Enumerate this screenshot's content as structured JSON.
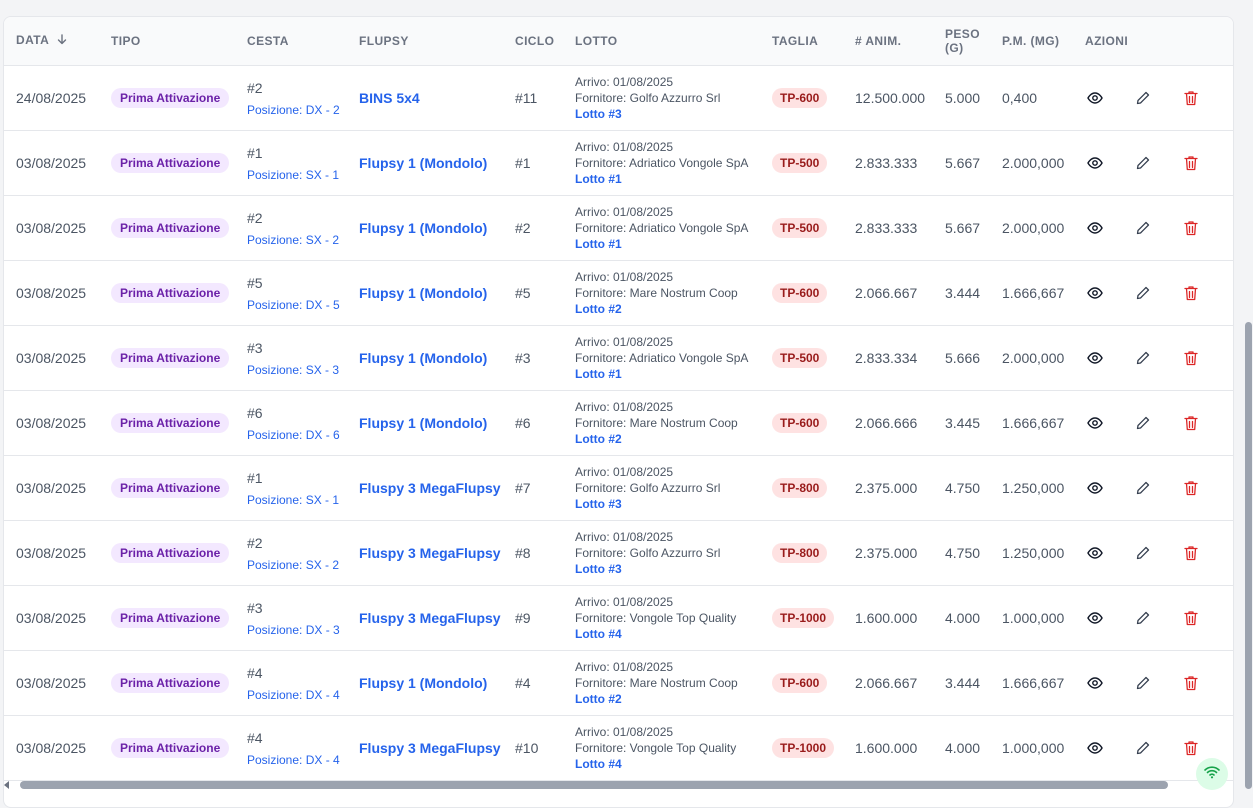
{
  "headers": {
    "data": "DATA",
    "tipo": "TIPO",
    "cesta": "CESTA",
    "flupsy": "FLUPSY",
    "ciclo": "CICLO",
    "lotto": "LOTTO",
    "taglia": "TAGLIA",
    "animali": "# ANIM.",
    "peso": "PESO (G)",
    "pm": "P.M. (MG)",
    "azioni": "AZIONI"
  },
  "rows": [
    {
      "data": "24/08/2025",
      "tipo": "Prima Attivazione",
      "cesta": "#2",
      "posizione": "Posizione: DX - 2",
      "flupsy": "BINS 5x4",
      "ciclo": "#11",
      "arrivo": "Arrivo: 01/08/2025",
      "fornitore": "Fornitore: Golfo Azzurro Srl",
      "lotto": "Lotto #3",
      "taglia": "TP-600",
      "animali": "12.500.000",
      "peso": "5.000",
      "pm": "0,400"
    },
    {
      "data": "03/08/2025",
      "tipo": "Prima Attivazione",
      "cesta": "#1",
      "posizione": "Posizione: SX - 1",
      "flupsy": "Flupsy 1 (Mondolo)",
      "ciclo": "#1",
      "arrivo": "Arrivo: 01/08/2025",
      "fornitore": "Fornitore: Adriatico Vongole SpA",
      "lotto": "Lotto #1",
      "taglia": "TP-500",
      "animali": "2.833.333",
      "peso": "5.667",
      "pm": "2.000,000"
    },
    {
      "data": "03/08/2025",
      "tipo": "Prima Attivazione",
      "cesta": "#2",
      "posizione": "Posizione: SX - 2",
      "flupsy": "Flupsy 1 (Mondolo)",
      "ciclo": "#2",
      "arrivo": "Arrivo: 01/08/2025",
      "fornitore": "Fornitore: Adriatico Vongole SpA",
      "lotto": "Lotto #1",
      "taglia": "TP-500",
      "animali": "2.833.333",
      "peso": "5.667",
      "pm": "2.000,000"
    },
    {
      "data": "03/08/2025",
      "tipo": "Prima Attivazione",
      "cesta": "#5",
      "posizione": "Posizione: DX - 5",
      "flupsy": "Flupsy 1 (Mondolo)",
      "ciclo": "#5",
      "arrivo": "Arrivo: 01/08/2025",
      "fornitore": "Fornitore: Mare Nostrum Coop",
      "lotto": "Lotto #2",
      "taglia": "TP-600",
      "animali": "2.066.667",
      "peso": "3.444",
      "pm": "1.666,667"
    },
    {
      "data": "03/08/2025",
      "tipo": "Prima Attivazione",
      "cesta": "#3",
      "posizione": "Posizione: SX - 3",
      "flupsy": "Flupsy 1 (Mondolo)",
      "ciclo": "#3",
      "arrivo": "Arrivo: 01/08/2025",
      "fornitore": "Fornitore: Adriatico Vongole SpA",
      "lotto": "Lotto #1",
      "taglia": "TP-500",
      "animali": "2.833.334",
      "peso": "5.666",
      "pm": "2.000,000"
    },
    {
      "data": "03/08/2025",
      "tipo": "Prima Attivazione",
      "cesta": "#6",
      "posizione": "Posizione: DX - 6",
      "flupsy": "Flupsy 1 (Mondolo)",
      "ciclo": "#6",
      "arrivo": "Arrivo: 01/08/2025",
      "fornitore": "Fornitore: Mare Nostrum Coop",
      "lotto": "Lotto #2",
      "taglia": "TP-600",
      "animali": "2.066.666",
      "peso": "3.445",
      "pm": "1.666,667"
    },
    {
      "data": "03/08/2025",
      "tipo": "Prima Attivazione",
      "cesta": "#1",
      "posizione": "Posizione: SX - 1",
      "flupsy": "Fluspy 3 MegaFlupsy",
      "ciclo": "#7",
      "arrivo": "Arrivo: 01/08/2025",
      "fornitore": "Fornitore: Golfo Azzurro Srl",
      "lotto": "Lotto #3",
      "taglia": "TP-800",
      "animali": "2.375.000",
      "peso": "4.750",
      "pm": "1.250,000"
    },
    {
      "data": "03/08/2025",
      "tipo": "Prima Attivazione",
      "cesta": "#2",
      "posizione": "Posizione: SX - 2",
      "flupsy": "Fluspy 3 MegaFlupsy",
      "ciclo": "#8",
      "arrivo": "Arrivo: 01/08/2025",
      "fornitore": "Fornitore: Golfo Azzurro Srl",
      "lotto": "Lotto #3",
      "taglia": "TP-800",
      "animali": "2.375.000",
      "peso": "4.750",
      "pm": "1.250,000"
    },
    {
      "data": "03/08/2025",
      "tipo": "Prima Attivazione",
      "cesta": "#3",
      "posizione": "Posizione: DX - 3",
      "flupsy": "Fluspy 3 MegaFlupsy",
      "ciclo": "#9",
      "arrivo": "Arrivo: 01/08/2025",
      "fornitore": "Fornitore: Vongole Top Quality",
      "lotto": "Lotto #4",
      "taglia": "TP-1000",
      "animali": "1.600.000",
      "peso": "4.000",
      "pm": "1.000,000"
    },
    {
      "data": "03/08/2025",
      "tipo": "Prima Attivazione",
      "cesta": "#4",
      "posizione": "Posizione: DX - 4",
      "flupsy": "Flupsy 1 (Mondolo)",
      "ciclo": "#4",
      "arrivo": "Arrivo: 01/08/2025",
      "fornitore": "Fornitore: Mare Nostrum Coop",
      "lotto": "Lotto #2",
      "taglia": "TP-600",
      "animali": "2.066.667",
      "peso": "3.444",
      "pm": "1.666,667"
    },
    {
      "data": "03/08/2025",
      "tipo": "Prima Attivazione",
      "cesta": "#4",
      "posizione": "Posizione: DX - 4",
      "flupsy": "Fluspy 3 MegaFlupsy",
      "ciclo": "#10",
      "arrivo": "Arrivo: 01/08/2025",
      "fornitore": "Fornitore: Vongole Top Quality",
      "lotto": "Lotto #4",
      "taglia": "TP-1000",
      "animali": "1.600.000",
      "peso": "4.000",
      "pm": "1.000,000"
    }
  ],
  "icons": {
    "sort": "arrow-down-icon",
    "view": "eye-icon",
    "edit": "pencil-icon",
    "delete": "trash-icon",
    "status": "wifi-icon"
  },
  "colors": {
    "link": "#2563eb",
    "type_badge_bg": "#f3e8ff",
    "type_badge_text": "#6b21a8",
    "size_badge_bg": "#fee2e2",
    "size_badge_text": "#991b1b",
    "delete": "#dc2626"
  }
}
